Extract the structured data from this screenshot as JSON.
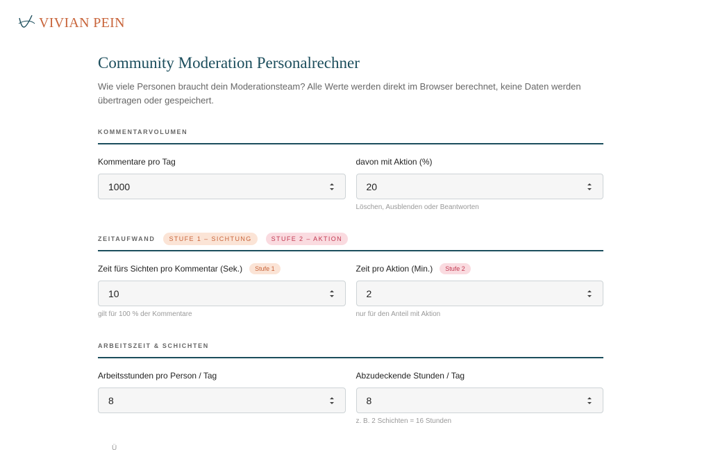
{
  "brand": {
    "name": "VIVIAN PEIN",
    "accent": "#c8643a",
    "primary": "#1b4d5c"
  },
  "page": {
    "title": "Community Moderation Personalrechner",
    "intro": "Wie viele Personen braucht dein Moderationsteam? Alle Werte werden direkt im Browser berechnet, keine Daten werden übertragen oder gespeichert."
  },
  "sections": [
    {
      "title": "KOMMENTARVOLUMEN",
      "badges": [],
      "fields": [
        {
          "label": "Kommentare pro Tag",
          "value": "1000",
          "hint": ""
        },
        {
          "label": "davon mit Aktion (%)",
          "value": "20",
          "hint": "Löschen, Ausblenden oder Beantworten"
        }
      ]
    },
    {
      "title": "ZEITAUFWAND",
      "badges": [
        "STUFE 1 – SICHTUNG",
        "STUFE 2 – AKTION"
      ],
      "fields": [
        {
          "label": "Zeit fürs Sichten pro Kommentar (Sek.)",
          "badge": "Stufe 1",
          "value": "10",
          "hint": "gilt für 100 % der Kommentare"
        },
        {
          "label": "Zeit pro Aktion (Min.)",
          "badge": "Stufe 2",
          "value": "2",
          "hint": "nur für den Anteil mit Aktion"
        }
      ]
    },
    {
      "title": "ARBEITSZEIT & SCHICHTEN",
      "badges": [],
      "fields": [
        {
          "label": "Arbeitsstunden pro Person / Tag",
          "value": "8",
          "hint": ""
        },
        {
          "label": "Abzudeckende Stunden / Tag",
          "value": "8",
          "hint": "z. B. 2 Schichten = 16 Stunden"
        }
      ]
    }
  ],
  "cutoff_text": "Ü"
}
